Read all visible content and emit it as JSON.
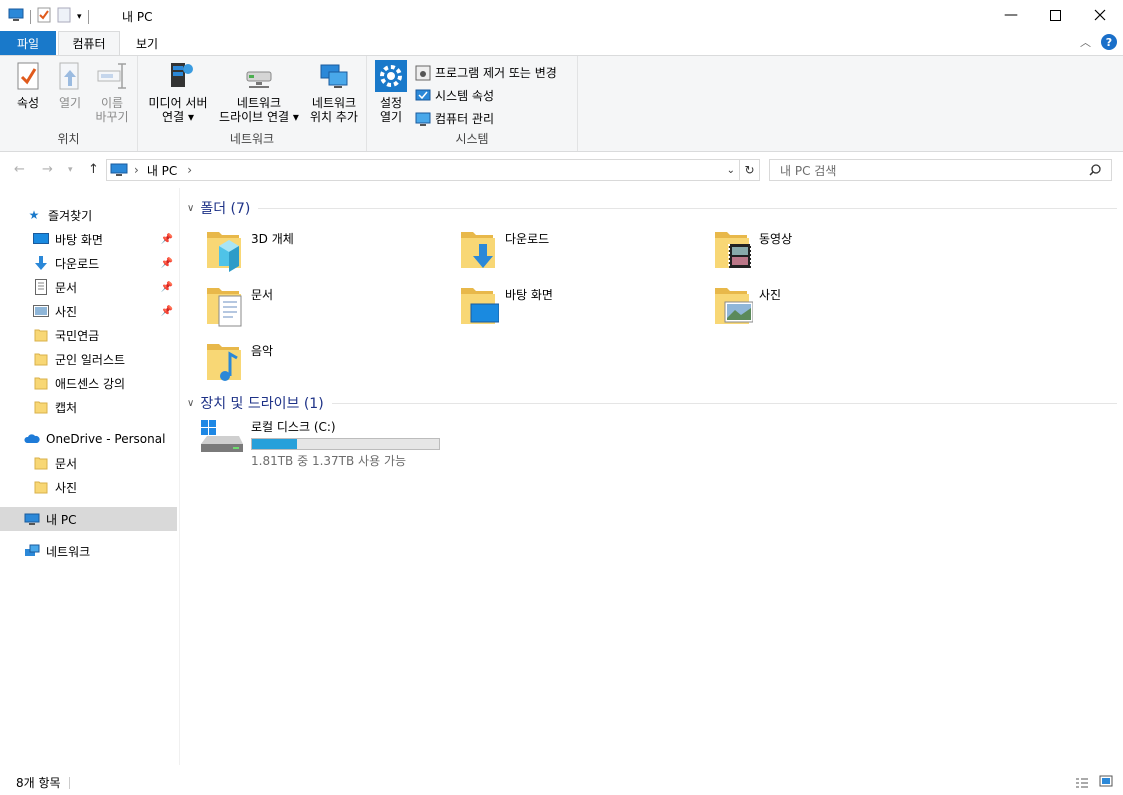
{
  "window": {
    "title": "내 PC"
  },
  "tabs": {
    "file": "파일",
    "computer": "컴퓨터",
    "view": "보기"
  },
  "ribbon": {
    "location": {
      "label": "위치",
      "properties": "속성",
      "open": "열기",
      "rename_1": "이름",
      "rename_2": "바꾸기"
    },
    "network": {
      "label": "네트워크",
      "media_1": "미디어 서버",
      "media_2": "연결",
      "map_1": "네트워크",
      "map_2": "드라이브 연결",
      "add_1": "네트워크",
      "add_2": "위치 추가"
    },
    "system": {
      "label": "시스템",
      "settings_1": "설정",
      "settings_2": "열기",
      "uninstall": "프로그램 제거 또는 변경",
      "sysprops": "시스템 속성",
      "manage": "컴퓨터 관리"
    }
  },
  "address": {
    "path_root": "내 PC",
    "search_placeholder": "내 PC 검색"
  },
  "nav": {
    "quick_access": "즐겨찾기",
    "quick_items": [
      "바탕 화면",
      "다운로드",
      "문서",
      "사진",
      "국민연금",
      "군인 일러스트",
      "애드센스 강의",
      "캡처"
    ],
    "onedrive": "OneDrive - Personal",
    "onedrive_items": [
      "문서",
      "사진"
    ],
    "this_pc": "내 PC",
    "network": "네트워크"
  },
  "folders": {
    "header": "폴더 (7)",
    "items": [
      "3D 개체",
      "다운로드",
      "동영상",
      "문서",
      "바탕 화면",
      "사진",
      "음악"
    ]
  },
  "drives": {
    "header": "장치 및 드라이브 (1)",
    "items": [
      {
        "name": "로컬 디스크 (C:)",
        "space": "1.81TB 중 1.37TB 사용 가능",
        "used_fraction": 0.243
      }
    ]
  },
  "status": {
    "count": "8개 항목"
  },
  "colors": {
    "accent": "#1979ca",
    "folder": "#f8d775",
    "drive_bar": "#26a0da"
  }
}
